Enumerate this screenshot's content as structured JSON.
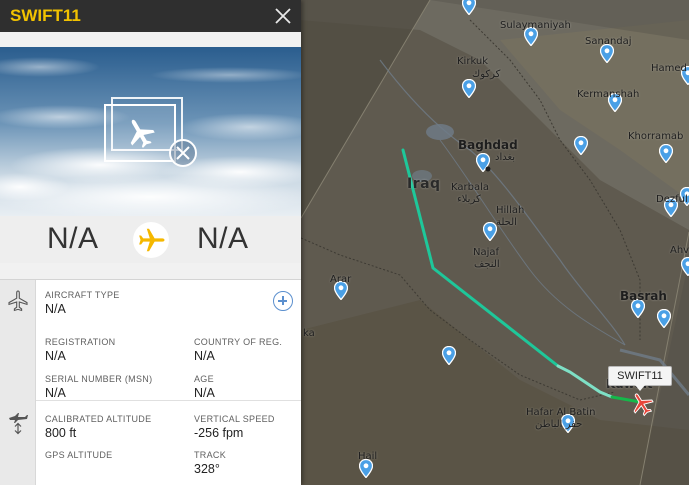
{
  "flight": {
    "callsign": "SWIFT11",
    "origin_code": "N/A",
    "destination_code": "N/A"
  },
  "aircraft": {
    "aircraft_type_label": "AIRCRAFT TYPE",
    "aircraft_type_value": "N/A",
    "registration_label": "REGISTRATION",
    "registration_value": "N/A",
    "country_label": "COUNTRY OF REG.",
    "country_value": "N/A",
    "serial_label": "SERIAL NUMBER (MSN)",
    "serial_value": "N/A",
    "age_label": "AGE",
    "age_value": "N/A"
  },
  "position": {
    "cal_alt_label": "CALIBRATED ALTITUDE",
    "cal_alt_value": "800 ft",
    "vspeed_label": "VERTICAL SPEED",
    "vspeed_value": "-256 fpm",
    "gps_alt_label": "GPS ALTITUDE",
    "gps_alt_value": "",
    "track_label": "TRACK",
    "track_value": "328°"
  },
  "map": {
    "country_label": "Iraq",
    "places": {
      "sulaymaniyah": "Sulaymaniyah",
      "sanandaj": "Sanandaj",
      "hamedan": "Hamed",
      "kirkuk_en": "Kirkuk",
      "kirkuk_ar": "كركوك",
      "kermanshah": "Kermanshah",
      "baghdad_en": "Baghdad",
      "baghdad_ar": "بغداد",
      "khorramabad": "Khorramab",
      "karbala_en": "Karbala",
      "karbala_ar": "كربلاء",
      "hillah_en": "Hillah",
      "hillah_ar": "الحلة",
      "dezful": "Dezful",
      "najaf_en": "Najaf",
      "najaf_ar": "النجف",
      "ahvaz": "Ahv",
      "arar": "Arar",
      "basrah": "Basrah",
      "ka": "ka",
      "kuwait": "Kuwait",
      "hafar_en": "Hafar Al Batin",
      "hafar_ar": "حفر الباطن",
      "hail": "Hail"
    }
  },
  "colors": {
    "callsign": "#f2c200",
    "track_line": "#1ec79a",
    "plane_marker": "#e8463b",
    "pin": "#4aa0e6"
  },
  "icons": {
    "close": "close-icon",
    "photo_placeholder": "no-photo-icon",
    "route_plane": "airplane-icon",
    "aircraft_section": "aircraft-section-icon",
    "position_section": "altitude-section-icon",
    "add": "add-icon",
    "map_pin": "location-pin-icon",
    "aircraft_marker": "aircraft-marker-icon"
  }
}
